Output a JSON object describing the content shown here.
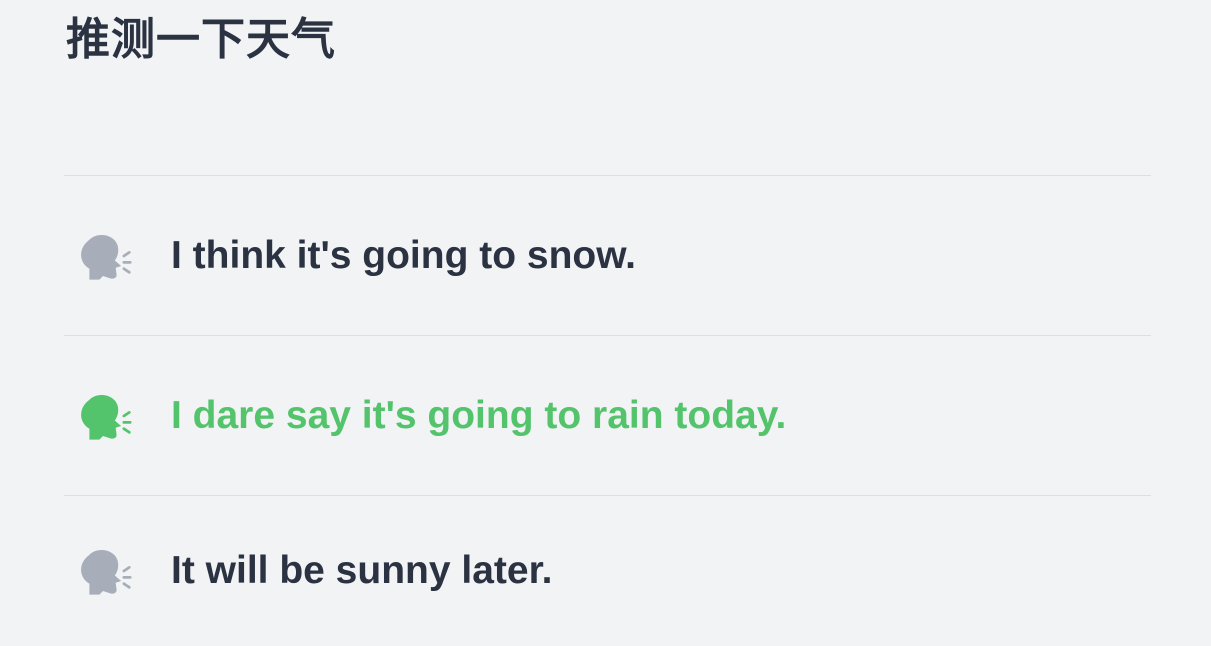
{
  "page": {
    "title": "推测一下天气"
  },
  "phrases": [
    {
      "text": "I think it's going to snow.",
      "state": "inactive",
      "icon": "speaking-head-icon"
    },
    {
      "text": "I dare say it's going to rain today.",
      "state": "active",
      "icon": "speaking-head-icon"
    },
    {
      "text": "It will be sunny later.",
      "state": "inactive",
      "icon": "speaking-head-icon"
    }
  ],
  "colors": {
    "background": "#f2f3f5",
    "text": "#2b3242",
    "active": "#54c46c",
    "inactive_icon": "#a7adb9",
    "divider": "#dcdfe5"
  }
}
